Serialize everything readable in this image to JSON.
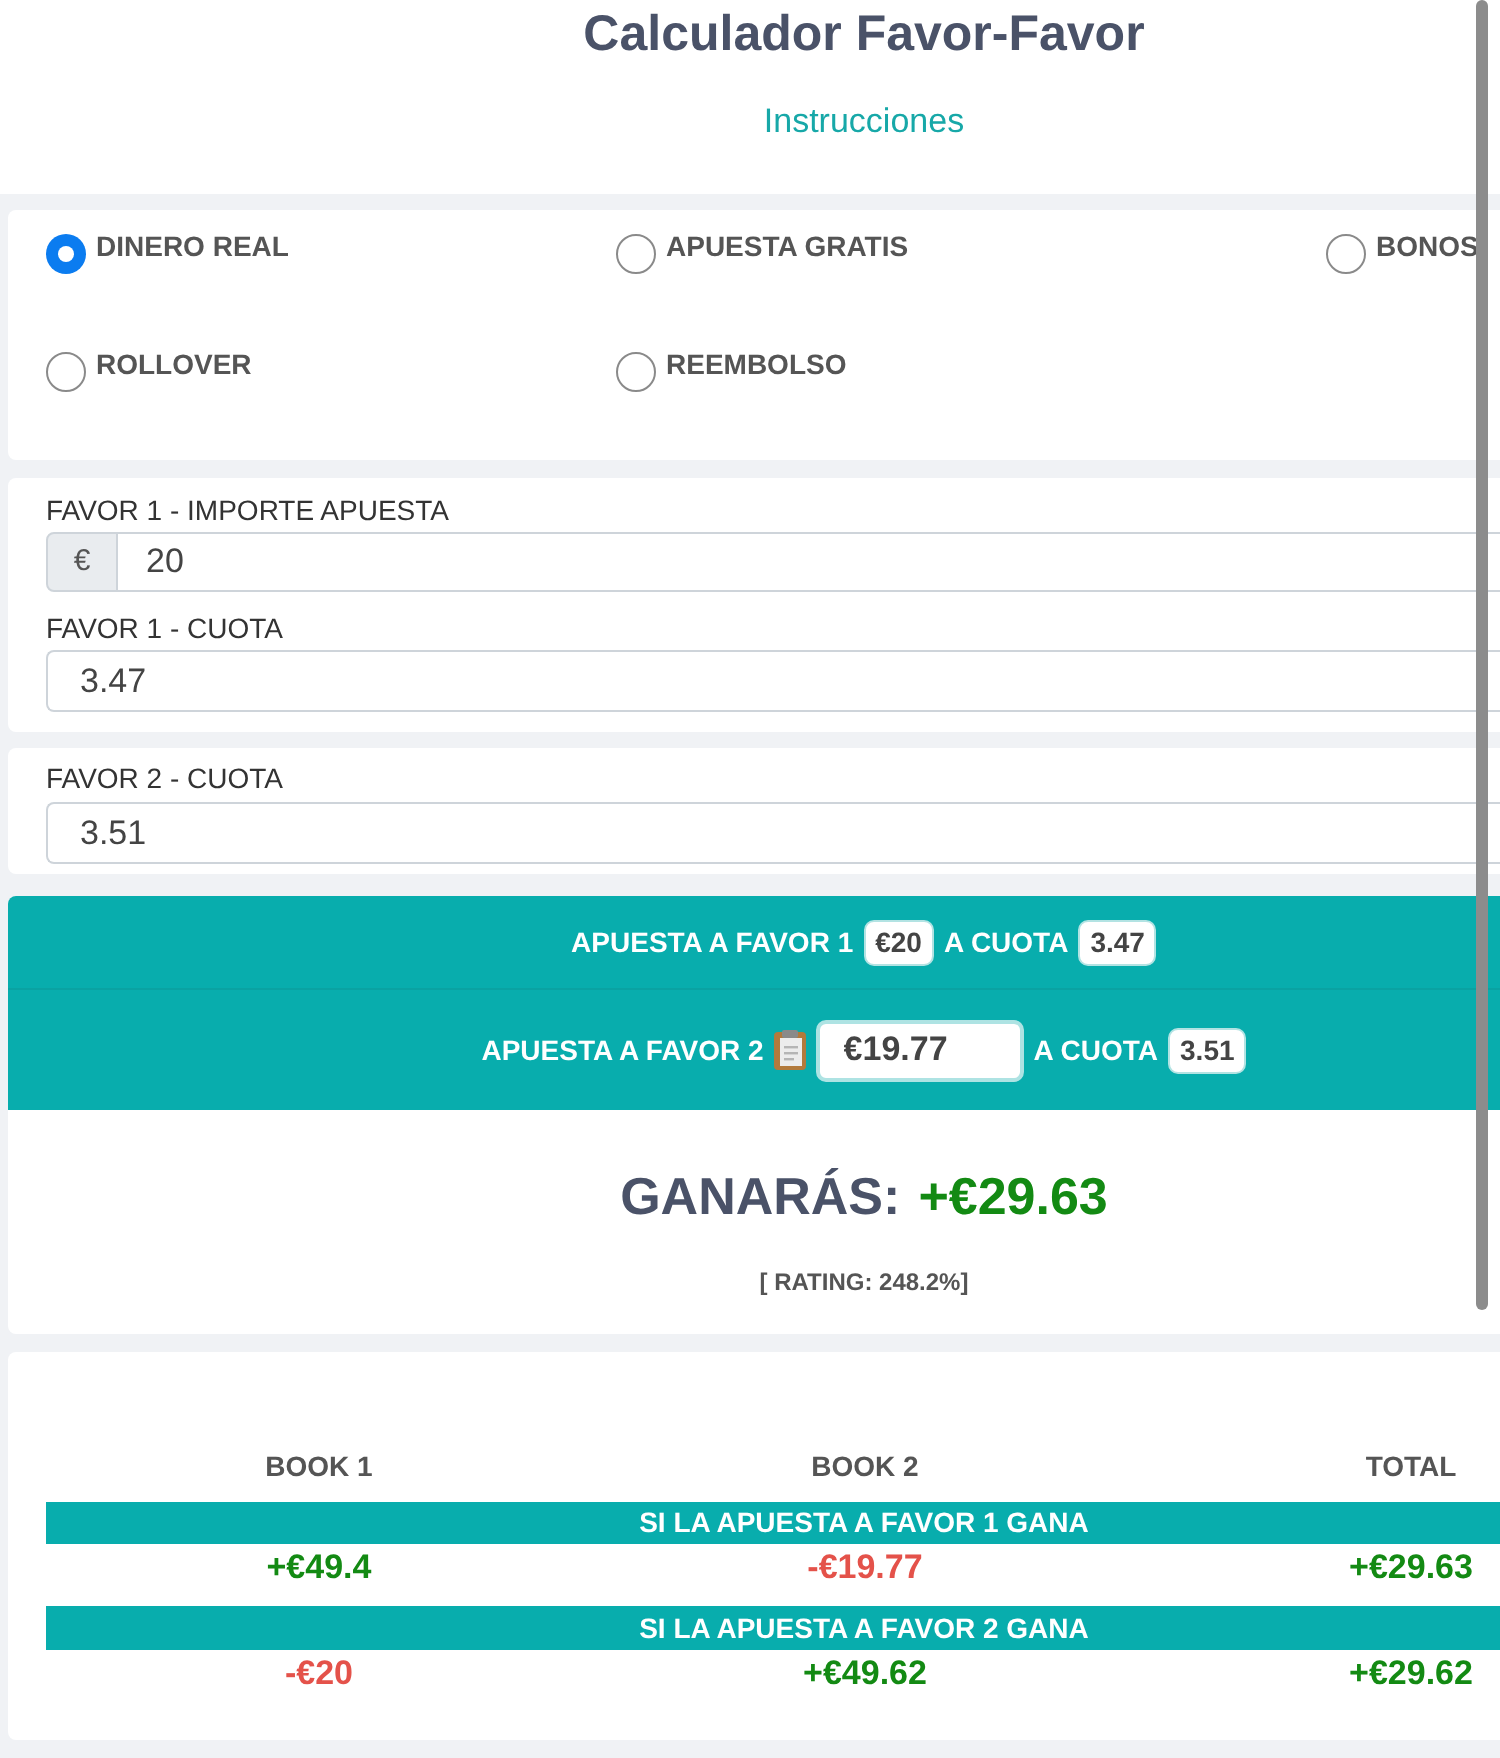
{
  "header": {
    "title": "Calculador Favor-Favor",
    "link": "Instrucciones"
  },
  "bet_types": [
    {
      "label": "DINERO REAL",
      "selected": true
    },
    {
      "label": "APUESTA GRATIS",
      "selected": false
    },
    {
      "label": "BONOS",
      "selected": false
    },
    {
      "label": "ROLLOVER",
      "selected": false
    },
    {
      "label": "REEMBOLSO",
      "selected": false
    }
  ],
  "input_cards": [
    {
      "fields": [
        {
          "label": "FAVOR 1 - IMPORTE APUESTA",
          "prefix": "€",
          "value": "20"
        },
        {
          "label": "FAVOR 1 - CUOTA",
          "value": "3.47"
        }
      ]
    },
    {
      "fields": [
        {
          "label": "FAVOR 2 - CUOTA",
          "value": "3.51"
        }
      ]
    }
  ],
  "bets": [
    {
      "kind": "fixed",
      "label": "APUESTA A FAVOR 1",
      "stake": "€20",
      "odds_label": "A CUOTA",
      "odds": "3.47"
    },
    {
      "kind": "editable",
      "label": "APUESTA A FAVOR 2",
      "stake": "€19.77",
      "odds_label": "A CUOTA",
      "odds": "3.51"
    }
  ],
  "result": {
    "label": "GANARÁS:",
    "profit": "+€29.63",
    "rating": "[ RATING: 248.2%]"
  },
  "outcomes": {
    "columns": [
      "BOOK 1",
      "BOOK 2",
      "TOTAL"
    ],
    "groups": [
      {
        "title": "SI LA APUESTA A FAVOR 1 GANA",
        "cells": [
          {
            "text": "+€49.4",
            "color": "#138a13"
          },
          {
            "text": "-€19.77",
            "color": "#e4524a"
          },
          {
            "text": "+€29.63",
            "color": "#138a13"
          }
        ]
      },
      {
        "title": "SI LA APUESTA A FAVOR 2 GANA",
        "cells": [
          {
            "text": "-€20",
            "color": "#e4524a"
          },
          {
            "text": "+€49.62",
            "color": "#138a13"
          },
          {
            "text": "+€29.62",
            "color": "#138a13"
          }
        ]
      }
    ]
  }
}
